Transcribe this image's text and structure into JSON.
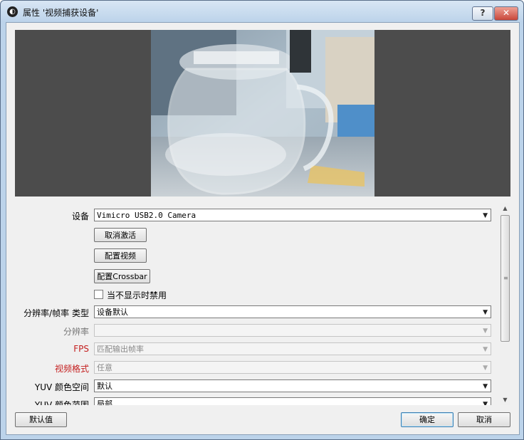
{
  "window": {
    "app_icon": "obs-logo-icon",
    "title": "属性 '视频捕获设备'",
    "help_label": "?",
    "close_label": "✕"
  },
  "properties": {
    "device_label": "设备",
    "device_value": "Vimicro USB2.0 Camera",
    "deactivate_label": "取消激活",
    "configure_video_label": "配置视频",
    "configure_crossbar_label": "配置Crossbar",
    "deactivate_when_hidden_label": "当不显示时禁用",
    "deactivate_when_hidden_checked": false,
    "res_fps_type_label": "分辨率/帧率 类型",
    "res_fps_type_value": "设备默认",
    "resolution_label": "分辨率",
    "resolution_value": "",
    "fps_label": "FPS",
    "fps_value": "匹配输出帧率",
    "video_format_label": "视频格式",
    "video_format_value": "任意",
    "yuv_color_space_label": "YUV 颜色空间",
    "yuv_color_space_value": "默认",
    "yuv_color_range_label": "YUV 颜色范围",
    "yuv_color_range_value": "局部"
  },
  "footer": {
    "defaults_label": "默认值",
    "ok_label": "确定",
    "cancel_label": "取消"
  },
  "colors": {
    "required_label": "#c42020",
    "preview_background": "#4c4c4c"
  }
}
